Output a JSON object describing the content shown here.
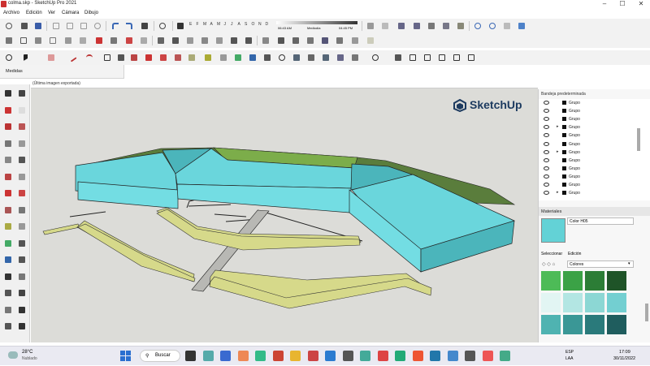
{
  "window": {
    "title": "colma.skp - SketchUp Pro 2021",
    "controls": [
      "–",
      "☐",
      "✕"
    ]
  },
  "menu": [
    "Archivo",
    "Edición",
    "Ver",
    "Cámara",
    "Dibujo"
  ],
  "shadows": {
    "letters": [
      "E",
      "F",
      "M",
      "A",
      "M",
      "J",
      "J",
      "A",
      "S",
      "O",
      "N",
      "D"
    ],
    "time_start": "06:43 AM",
    "time_mid": "Mediodía",
    "time_end": "04:45 PM"
  },
  "measures_label": "Medidas",
  "viewport": {
    "header": "(Última imagen exportada)",
    "brand": "SketchUp"
  },
  "tray": {
    "title": "Bandeja predeterminada",
    "outline_items": [
      {
        "label": "Grupo",
        "arrow": ""
      },
      {
        "label": "Grupo",
        "arrow": ""
      },
      {
        "label": "Grupo",
        "arrow": ""
      },
      {
        "label": "Grupo",
        "arrow": "▸"
      },
      {
        "label": "Grupo",
        "arrow": ""
      },
      {
        "label": "Grupo",
        "arrow": ""
      },
      {
        "label": "Grupo",
        "arrow": "▸"
      },
      {
        "label": "Grupo",
        "arrow": ""
      },
      {
        "label": "Grupo",
        "arrow": ""
      },
      {
        "label": "Grupo",
        "arrow": ""
      },
      {
        "label": "Grupo",
        "arrow": ""
      },
      {
        "label": "Grupo",
        "arrow": "▸"
      }
    ],
    "materials_title": "Materiales",
    "material_name": "Color H05",
    "tab_select": "Seleccionar",
    "tab_edit": "Edición",
    "library": "Colores",
    "swatch_colors": [
      "#4dbb57",
      "#3ba246",
      "#2c7d36",
      "#1f5428",
      "#e2f5f3",
      "#b3e6e3",
      "#8cd7d4",
      "#73cfd1",
      "#4fb3b1",
      "#3a9796",
      "#2a7a7b",
      "#1f5d5e"
    ],
    "current_color": "#63d2d6",
    "accent_color": "#6ad6dc"
  },
  "taskbar": {
    "weather_temp": "28°C",
    "weather_desc": "Nublado",
    "search": "Buscar",
    "lang1": "ESP",
    "lang2": "LAA",
    "time": "17:09",
    "date": "30/11/2022"
  },
  "colors": {
    "roof_teal": "#6ad6dc",
    "roof_dark_teal": "#4bb5bb",
    "green": "#5a7d3c",
    "yellow": "#d6d98a",
    "ground": "#dcdcd8"
  }
}
